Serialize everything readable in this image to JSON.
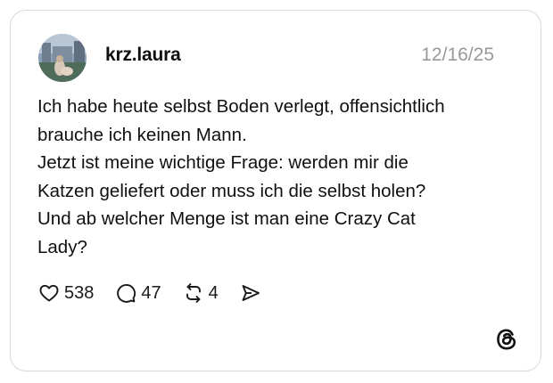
{
  "post": {
    "username": "krz.laura",
    "date": "12/16/25",
    "text_lines": [
      "Ich habe heute selbst Boden verlegt, offensichtlich",
      "brauche ich keinen Mann.",
      "Jetzt ist meine wichtige Frage: werden mir die",
      "Katzen geliefert oder muss ich die selbst holen?",
      "Und ab welcher Menge ist man eine Crazy Cat",
      "Lady?"
    ]
  },
  "actions": {
    "likes": "538",
    "comments": "47",
    "reposts": "4"
  },
  "icons": {
    "like": "heart-icon",
    "comment": "speech-bubble-icon",
    "repost": "repost-icon",
    "share": "send-icon",
    "brand": "threads-logo-icon"
  },
  "colors": {
    "text": "#101010",
    "muted": "#999999",
    "border": "#d9d9d9"
  }
}
